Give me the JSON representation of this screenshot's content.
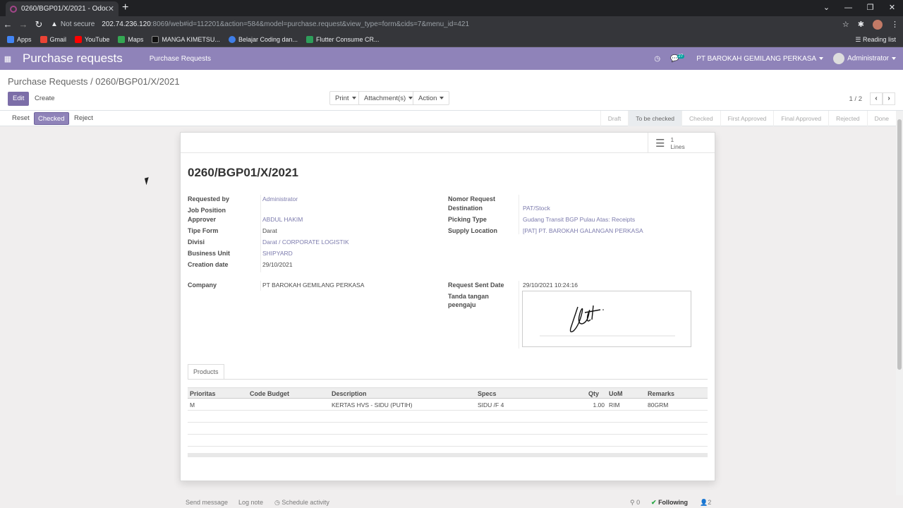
{
  "browser": {
    "tab_title": "0260/BGP01/X/2021 - Odoo",
    "not_secure": "Not secure",
    "url_host": "202.74.236.120",
    "url_path": ":8069/web#id=112201&action=584&model=purchase.request&view_type=form&cids=7&menu_id=421",
    "bookmarks": [
      "Apps",
      "Gmail",
      "YouTube",
      "Maps",
      "MANGA KIMETSU...",
      "Belajar Coding dan...",
      "Flutter Consume CR..."
    ],
    "reading_list": "Reading list"
  },
  "navbar": {
    "app_title": "Purchase requests",
    "menu_item": "Purchase Requests",
    "chat_count": "27",
    "company": "PT BAROKAH GEMILANG PERKASA",
    "user": "Administrator"
  },
  "control_panel": {
    "breadcrumb": "Purchase Requests / 0260/BGP01/X/2021",
    "edit": "Edit",
    "create": "Create",
    "print": "Print",
    "attachments": "Attachment(s)",
    "action": "Action",
    "pager": "1 / 2"
  },
  "statusbar": {
    "buttons": [
      "Reset",
      "Checked",
      "Reject"
    ],
    "stages": [
      "Draft",
      "To be checked",
      "Checked",
      "First Approved",
      "Final Approved",
      "Rejected",
      "Done"
    ],
    "current_stage": "To be checked"
  },
  "sheet": {
    "lines_count": "1",
    "lines_label": "Lines",
    "title": "0260/BGP01/X/2021",
    "left_fields": [
      {
        "label": "Requested by",
        "value": "Administrator"
      },
      {
        "label": "Job Position",
        "value": ""
      },
      {
        "label": "Approver",
        "value": "ABDUL HAKIM"
      },
      {
        "label": "Tipe Form",
        "value": "Darat"
      },
      {
        "label": "Divisi",
        "value": "Darat / CORPORATE LOGISTIK"
      },
      {
        "label": "Business Unit",
        "value": "SHIPYARD"
      },
      {
        "label": "Creation date",
        "value": "29/10/2021"
      },
      {
        "label": "Company",
        "value": "PT BAROKAH GEMILANG PERKASA"
      }
    ],
    "right_fields": [
      {
        "label": "Nomor Request",
        "value": ""
      },
      {
        "label": "Destination",
        "value": "PAT/Stock"
      },
      {
        "label": "Picking Type",
        "value": "Gudang Transit BGP Pulau Atas: Receipts"
      },
      {
        "label": "Supply Location",
        "value": "[PAT] PT. BAROKAH GALANGAN PERKASA"
      },
      {
        "label": "Request Sent Date",
        "value": "29/10/2021 10:24:16"
      },
      {
        "label": "Tanda tangan",
        "value": ""
      },
      {
        "label": "peengaju",
        "value": ""
      }
    ],
    "notebook_tab": "Products",
    "table": {
      "headers": [
        "Prioritas",
        "Code Budget",
        "Description",
        "Specs",
        "Qty",
        "UoM",
        "Remarks"
      ],
      "rows": [
        [
          "M",
          "",
          "KERTAS HVS - SIDU (PUTIH)",
          "SIDU  /F 4",
          "1.00",
          "RIM",
          "80GRM"
        ]
      ]
    }
  },
  "chatter": {
    "send_message": "Send message",
    "log_note": "Log note",
    "schedule_activity": "Schedule activity",
    "attachments_count": "0",
    "following": "Following",
    "followers_count": "2"
  }
}
